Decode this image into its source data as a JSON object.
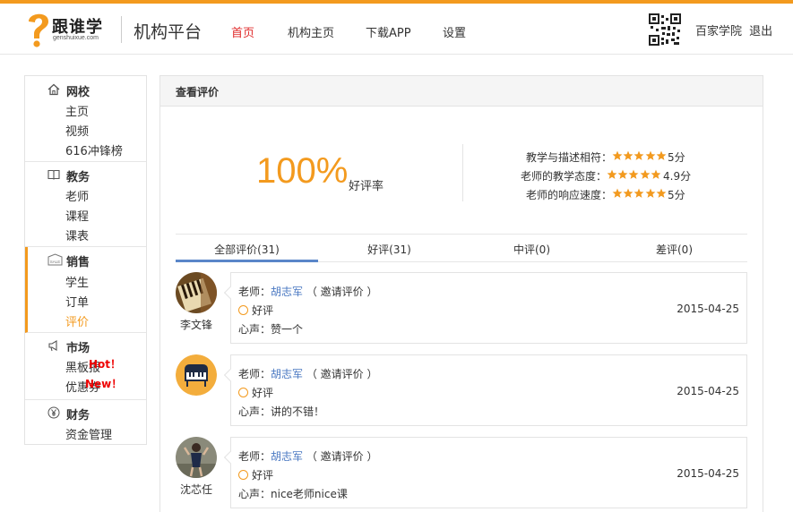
{
  "header": {
    "logo_brand": "跟谁学",
    "logo_domain": "genshuixue.com",
    "platform_title": "机构平台",
    "nav": [
      "首页",
      "机构主页",
      "下载APP",
      "设置"
    ],
    "user_name": "百家学院",
    "logout": "退出"
  },
  "sidebar": {
    "sections": [
      {
        "title": "网校",
        "icon": "home-icon",
        "items": [
          "主页",
          "视频",
          "616冲锋榜"
        ]
      },
      {
        "title": "教务",
        "icon": "book-icon",
        "items": [
          "老师",
          "课程",
          "课表"
        ]
      },
      {
        "title": "销售",
        "icon": "sale-tag-icon",
        "icon_text": "SALE",
        "items": [
          "学生",
          "订单",
          "评价"
        ]
      },
      {
        "title": "市场",
        "icon": "megaphone-icon",
        "items": [
          "黑板报",
          "优惠券"
        ]
      },
      {
        "title": "财务",
        "icon": "yen-icon",
        "items": [
          "资金管理"
        ]
      }
    ],
    "badges": {
      "hot": "Hot！",
      "new": "New！"
    }
  },
  "main": {
    "title": "查看评价",
    "rate_value": "100%",
    "rate_label": "好评率",
    "scores": [
      {
        "label": "教学与描述相符：",
        "stars": 5,
        "value": "5分"
      },
      {
        "label": "老师的教学态度：",
        "stars": 4.9,
        "value": "4.9分"
      },
      {
        "label": "老师的响应速度：",
        "stars": 5,
        "value": "5分"
      }
    ],
    "tabs": [
      "全部评价(31)",
      "好评(31)",
      "中评(0)",
      "差评(0)"
    ],
    "reviews": [
      {
        "name": "李文锋",
        "teacher_prefix": "老师：",
        "teacher": "胡志军",
        "invite": "（ 邀请评价 ）",
        "rating": "好评",
        "comment": "心声：赞一个",
        "date": "2015-04-25"
      },
      {
        "name": "",
        "teacher_prefix": "老师：",
        "teacher": "胡志军",
        "invite": "（ 邀请评价 ）",
        "rating": "好评",
        "comment": "心声：讲的不错！",
        "date": "2015-04-25"
      },
      {
        "name": "沈芯任",
        "teacher_prefix": "老师：",
        "teacher": "胡志军",
        "invite": "（ 邀请评价 ）",
        "rating": "好评",
        "comment": "心声：nice老师nice课",
        "date": "2015-04-25"
      }
    ]
  },
  "colors": {
    "accent": "#f39a1e",
    "active_nav": "#e02b2b",
    "link": "#4a78c2",
    "tab_underline": "#5a86c9",
    "badge": "#ee0000"
  }
}
